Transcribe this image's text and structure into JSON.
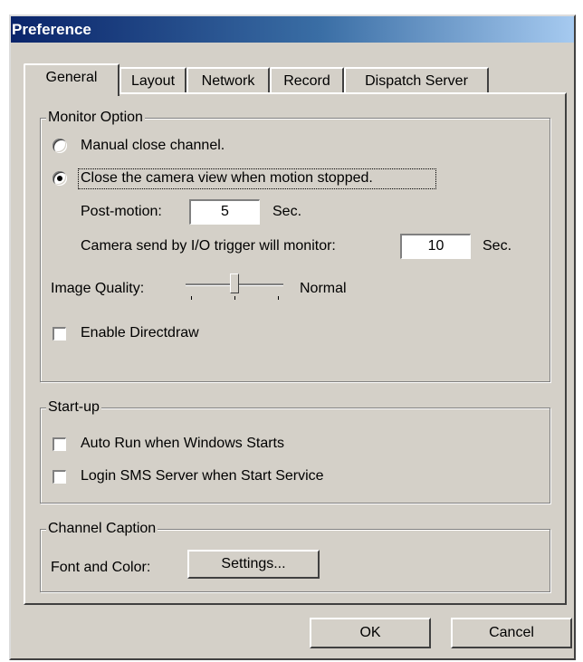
{
  "window": {
    "title": "Preference"
  },
  "tabs": [
    {
      "label": "General",
      "active": true
    },
    {
      "label": "Layout",
      "active": false
    },
    {
      "label": "Network",
      "active": false
    },
    {
      "label": "Record",
      "active": false
    },
    {
      "label": "Dispatch Server",
      "active": false
    }
  ],
  "monitor_option": {
    "title": "Monitor Option",
    "manual_close_label": "Manual close channel.",
    "close_when_stopped_label": "Close the camera view when motion stopped.",
    "selected": "close_when_stopped",
    "post_motion_label": "Post-motion:",
    "post_motion_value": "5",
    "post_motion_unit": "Sec.",
    "io_trigger_label": "Camera send by I/O trigger will monitor:",
    "io_trigger_value": "10",
    "io_trigger_unit": "Sec.",
    "image_quality_label": "Image Quality:",
    "image_quality_value": "Normal",
    "image_quality_level": 0.5,
    "directdraw_label": "Enable Directdraw",
    "directdraw_checked": false
  },
  "startup": {
    "title": "Start-up",
    "auto_run_label": "Auto Run when Windows Starts",
    "auto_run_checked": false,
    "login_sms_label": "Login SMS Server when Start Service",
    "login_sms_checked": false
  },
  "channel_caption": {
    "title": "Channel Caption",
    "font_color_label": "Font and Color:",
    "settings_button": "Settings..."
  },
  "buttons": {
    "ok": "OK",
    "cancel": "Cancel"
  }
}
